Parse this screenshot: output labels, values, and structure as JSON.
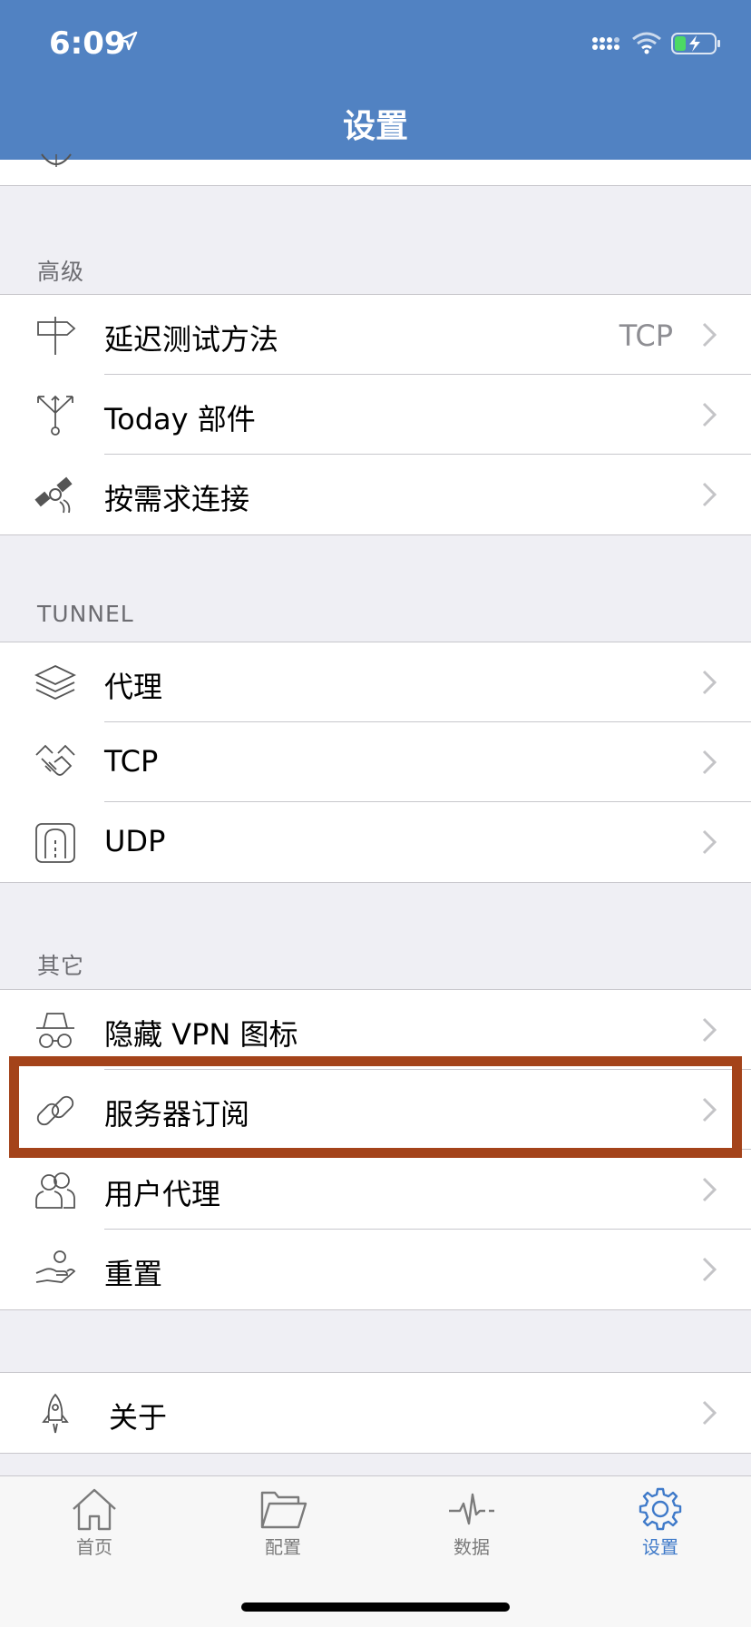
{
  "status": {
    "time": "6:09"
  },
  "nav": {
    "title": "设置"
  },
  "sections": {
    "advanced": {
      "header": "高级",
      "items": [
        {
          "label": "延迟测试方法",
          "value": "TCP",
          "icon": "signpost-icon"
        },
        {
          "label": "Today 部件",
          "icon": "fork-arrows-icon"
        },
        {
          "label": "按需求连接",
          "icon": "satellite-icon"
        }
      ]
    },
    "tunnel": {
      "header": "TUNNEL",
      "items": [
        {
          "label": "代理",
          "icon": "layers-icon"
        },
        {
          "label": "TCP",
          "icon": "handshake-icon"
        },
        {
          "label": "UDP",
          "icon": "tunnel-icon"
        }
      ]
    },
    "other": {
      "header": "其它",
      "items": [
        {
          "label": "隐藏 VPN 图标",
          "icon": "spy-icon"
        },
        {
          "label": "服务器订阅",
          "icon": "link-icon"
        },
        {
          "label": "用户代理",
          "icon": "users-icon"
        },
        {
          "label": "重置",
          "icon": "hand-reset-icon"
        }
      ]
    },
    "about": {
      "items": [
        {
          "label": "关于",
          "icon": "rocket-icon"
        }
      ]
    }
  },
  "tabs": [
    {
      "label": "首页",
      "icon": "home-icon"
    },
    {
      "label": "配置",
      "icon": "folder-icon"
    },
    {
      "label": "数据",
      "icon": "pulse-icon"
    },
    {
      "label": "设置",
      "icon": "gear-icon",
      "active": true
    }
  ],
  "colors": {
    "accent": "#5182c2",
    "tab_active": "#3f7ac9",
    "highlight": "#a4431a"
  }
}
